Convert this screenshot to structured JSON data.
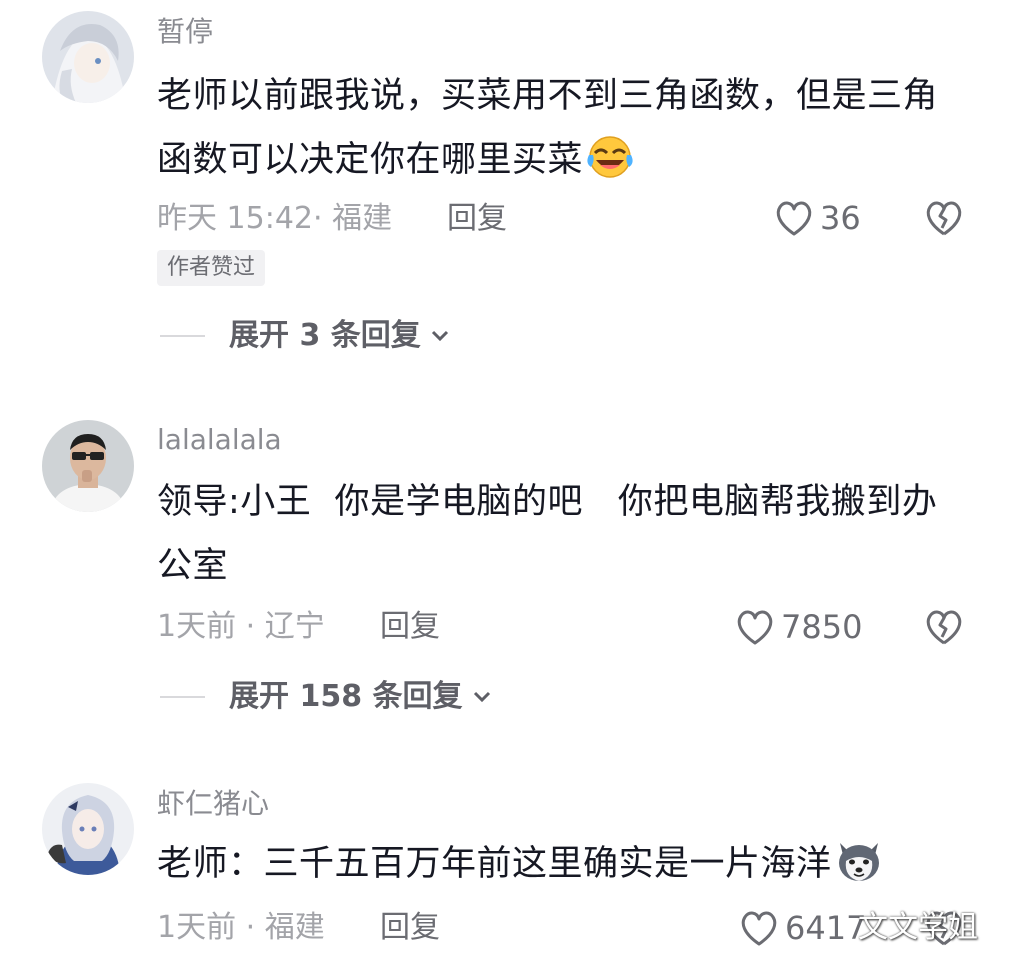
{
  "comments": [
    {
      "username": "暂停",
      "text": "老师以前跟我说，买菜用不到三角函数，但是三角函数可以决定你在哪里买菜",
      "emoji": "laughing-crying-emoji",
      "meta": "昨天 15:42· 福建",
      "reply_label": "回复",
      "likes": "36",
      "badge": "作者赞过",
      "expand_label": "展开 3 条回复"
    },
    {
      "username": "lalalalala",
      "text": "领导:小王  你是学电脑的吧   你把电脑帮我搬到办公室",
      "meta": "1天前 · 辽宁",
      "reply_label": "回复",
      "likes": "7850",
      "expand_label": "展开 158 条回复"
    },
    {
      "username": "虾仁猪心",
      "text": "老师：三千五百万年前这里确实是一片海洋",
      "emoji": "husky-dog-emoji",
      "meta": "1天前 · 福建",
      "reply_label": "回复",
      "likes": "6417"
    }
  ],
  "watermark": "文文学姐",
  "colors": {
    "text": "#161823",
    "muted": "#a3a4a9",
    "username": "#8a8b91",
    "badge_bg": "#f1f1f3"
  }
}
